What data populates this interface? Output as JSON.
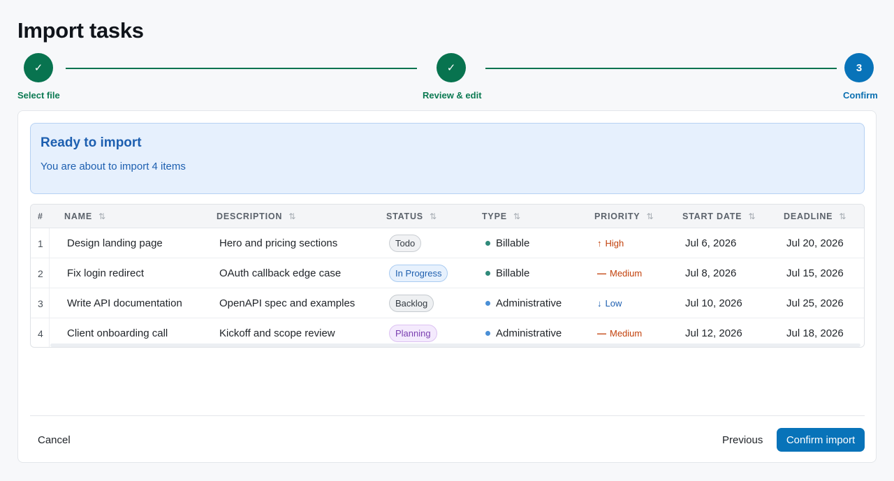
{
  "page": {
    "title": "Import tasks"
  },
  "stepper": {
    "steps": [
      {
        "label": "Select file",
        "marker": "✓",
        "state": "complete"
      },
      {
        "label": "Review & edit",
        "marker": "✓",
        "state": "complete"
      },
      {
        "label": "Confirm",
        "marker": "3",
        "state": "active"
      }
    ],
    "colors": {
      "complete": "#08734f",
      "active": "#0873b9"
    }
  },
  "alert": {
    "title": "Ready to import",
    "message": "You are about to import 4 items",
    "color": "#1d5fb0"
  },
  "table": {
    "headers": {
      "index": "#",
      "name": "NAME",
      "description": "DESCRIPTION",
      "status": "STATUS",
      "type": "TYPE",
      "priority": "PRIORITY",
      "start_date": "START DATE",
      "deadline": "DEADLINE"
    },
    "sort_icon": "⇅",
    "rows": [
      {
        "index": "1",
        "name": "Design landing page",
        "description": "Hero and pricing sections",
        "status": "Todo",
        "type": "Billable",
        "priority": "High",
        "priority_icon": "↑",
        "start_date": "Jul 6, 2026",
        "deadline": "Jul 20, 2026"
      },
      {
        "index": "2",
        "name": "Fix login redirect",
        "description": "OAuth callback edge case",
        "status": "In Progress",
        "type": "Billable",
        "priority": "Medium",
        "priority_icon": "—",
        "start_date": "Jul 8, 2026",
        "deadline": "Jul 15, 2026"
      },
      {
        "index": "3",
        "name": "Write API documentation",
        "description": "OpenAPI spec and examples",
        "status": "Backlog",
        "type": "Administrative",
        "priority": "Low",
        "priority_icon": "↓",
        "start_date": "Jul 10, 2026",
        "deadline": "Jul 25, 2026"
      },
      {
        "index": "4",
        "name": "Client onboarding call",
        "description": "Kickoff and scope review",
        "status": "Planning",
        "type": "Administrative",
        "priority": "Medium",
        "priority_icon": "—",
        "start_date": "Jul 12, 2026",
        "deadline": "Jul 18, 2026"
      }
    ],
    "type_colors": {
      "Billable": "#2f8a7a",
      "Administrative": "#4a8fd6"
    },
    "priority_colors": {
      "High": "#c2410c",
      "Medium": "#c2410c",
      "Low": "#1d5fb0"
    }
  },
  "footer": {
    "cancel_label": "Cancel",
    "previous_label": "Previous",
    "confirm_label": "Confirm import"
  }
}
